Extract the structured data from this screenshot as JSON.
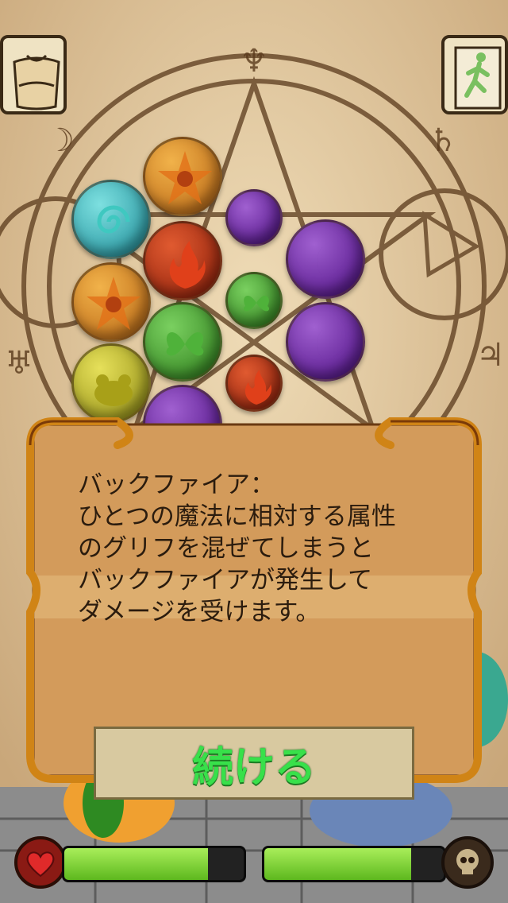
{
  "dialog": {
    "message": "バックファイア：\nひとつの魔法に相対する属性\nのグリフを混ぜてしまうと\nバックファイアが発生して\nダメージを受けます。",
    "continue_label": "続ける"
  },
  "hud": {
    "player_health": 0.8,
    "enemy_health": 0.82
  },
  "colors": {
    "accent_text": "#38e04a",
    "frame": "#d08416"
  },
  "icons": {
    "left_button": "bag-icon",
    "right_button": "exit-running-man-icon",
    "left_hud": "heart-icon",
    "right_hud": "skull-icon"
  },
  "orbs": [
    {
      "element": "sun",
      "color": "#d68a1e"
    },
    {
      "element": "water",
      "color": "#2aa8a8"
    },
    {
      "element": "moon",
      "color": "#6a1aa0"
    },
    {
      "element": "fire",
      "color": "#b42a10"
    },
    {
      "element": "moon",
      "color": "#6a1aa0"
    },
    {
      "element": "sun",
      "color": "#d68a1e"
    },
    {
      "element": "leaf",
      "color": "#3f9a22"
    },
    {
      "element": "leaf",
      "color": "#3f9a22"
    },
    {
      "element": "moon",
      "color": "#6a1aa0"
    },
    {
      "element": "earth",
      "color": "#b8b020"
    },
    {
      "element": "fire",
      "color": "#b42a10"
    },
    {
      "element": "moon",
      "color": "#6a1aa0"
    }
  ]
}
